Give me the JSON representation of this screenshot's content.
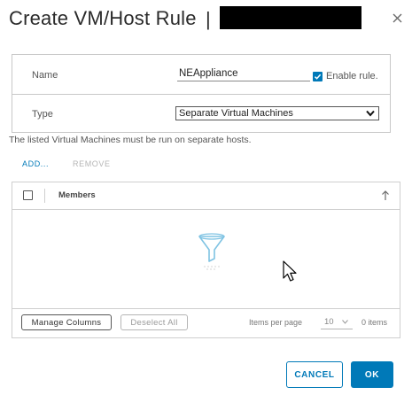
{
  "dialog": {
    "title": "Create VM/Host Rule",
    "title_separator": "|"
  },
  "form": {
    "name_label": "Name",
    "name_value": "NEAppliance",
    "enable_rule_label": "Enable rule.",
    "enable_rule_checked": true,
    "type_label": "Type",
    "type_value": "Separate Virtual Machines",
    "hint": "The listed Virtual Machines must be run on separate hosts."
  },
  "actions": {
    "add_label": "ADD...",
    "remove_label": "REMOVE"
  },
  "grid": {
    "columns": [
      "Members"
    ],
    "rows": [],
    "footer": {
      "manage_columns_label": "Manage Columns",
      "deselect_all_label": "Deselect All",
      "items_per_page_label": "Items per page",
      "items_per_page_value": "10",
      "item_count": "0 items"
    }
  },
  "buttons": {
    "cancel_label": "CANCEL",
    "ok_label": "OK"
  },
  "colors": {
    "accent": "#0079b8",
    "disabled": "#b5b5b5",
    "border": "#cfcfcf",
    "empty_icon": "#7fc3e3"
  },
  "icons": {
    "close": "close-icon",
    "checkbox": "checkmark-icon",
    "select_caret": "chevron-down-icon",
    "sort": "arrow-up-icon",
    "empty_state": "filter-funnel-icon",
    "pointer": "mouse-cursor-icon"
  }
}
